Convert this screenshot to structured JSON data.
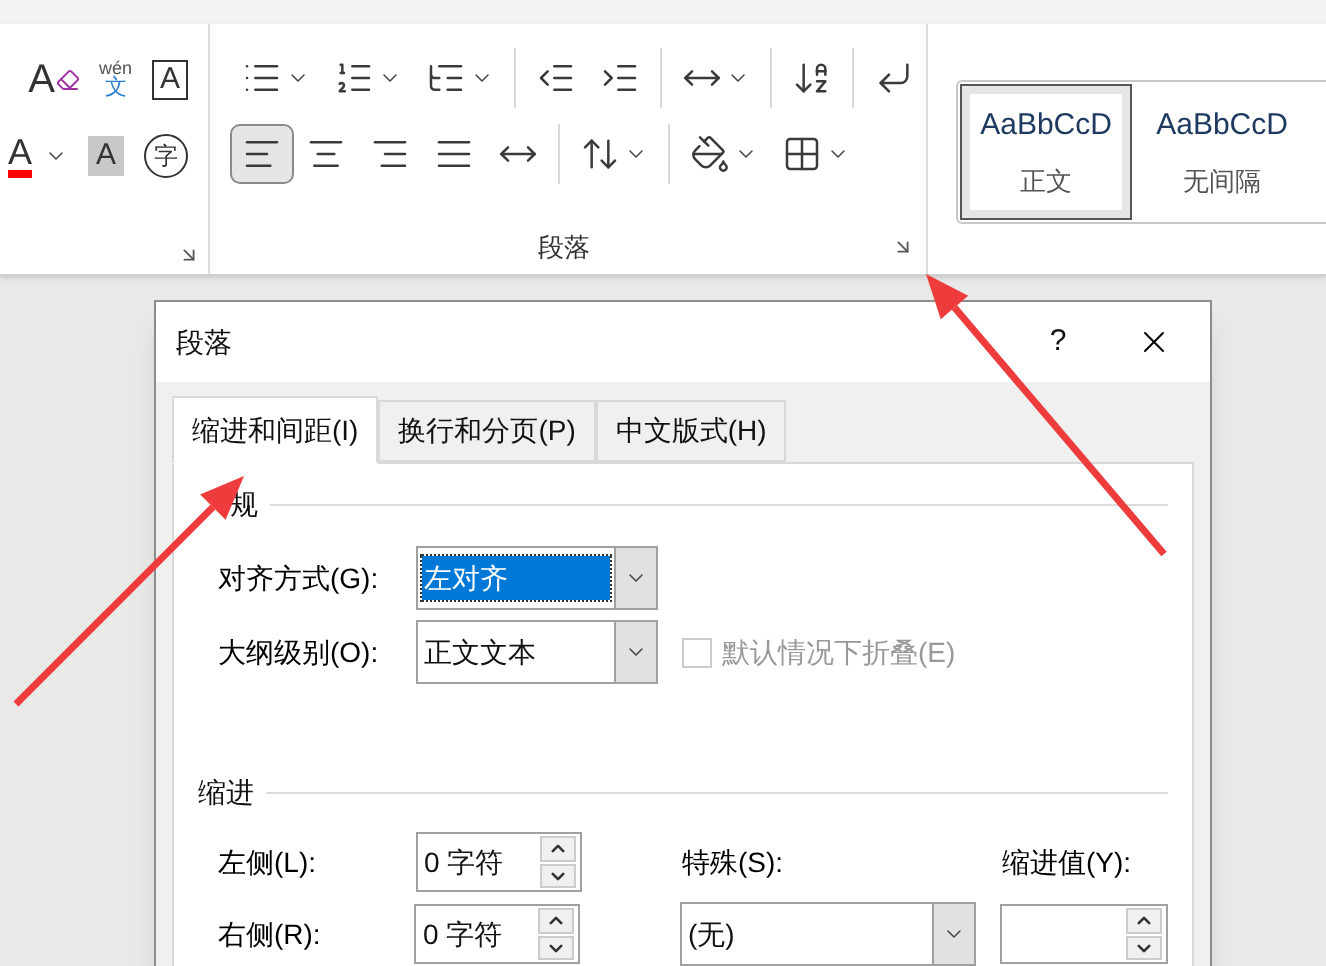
{
  "ribbon": {
    "font_group": {
      "rows": [
        [
          {
            "kind": "clear-format",
            "glyph": "A",
            "menu": false
          },
          {
            "kind": "phonetic",
            "ruby": "wén",
            "glyph": "文",
            "menu": false
          },
          {
            "kind": "char-border",
            "glyph": "A",
            "menu": false
          }
        ],
        [
          {
            "kind": "font-color",
            "glyph": "A",
            "color": "#ff0000",
            "menu": true
          },
          {
            "kind": "char-shading",
            "glyph": "A",
            "menu": false
          },
          {
            "kind": "enclose",
            "glyph": "字",
            "menu": false
          }
        ]
      ]
    },
    "paragraph_group": {
      "label": "段落",
      "rows": [
        [
          {
            "kind": "bullets",
            "menu": true,
            "selected": false
          },
          {
            "kind": "numbering",
            "menu": true,
            "selected": false
          },
          {
            "kind": "multilevel",
            "menu": true,
            "selected": false
          },
          {
            "kind": "separator"
          },
          {
            "kind": "decrease-indent",
            "menu": false,
            "selected": false
          },
          {
            "kind": "increase-indent",
            "menu": false,
            "selected": false
          },
          {
            "kind": "separator"
          },
          {
            "kind": "asian-layout",
            "menu": true,
            "selected": false
          },
          {
            "kind": "separator"
          },
          {
            "kind": "sort",
            "menu": false,
            "selected": false
          },
          {
            "kind": "separator"
          },
          {
            "kind": "show-marks",
            "menu": false,
            "selected": false
          }
        ],
        [
          {
            "kind": "align-left",
            "menu": false,
            "selected": true
          },
          {
            "kind": "align-center",
            "menu": false,
            "selected": false
          },
          {
            "kind": "align-right",
            "menu": false,
            "selected": false
          },
          {
            "kind": "justify",
            "menu": false,
            "selected": false
          },
          {
            "kind": "distributed",
            "menu": false,
            "selected": false
          },
          {
            "kind": "separator"
          },
          {
            "kind": "line-spacing",
            "menu": true,
            "selected": false
          },
          {
            "kind": "separator"
          },
          {
            "kind": "shading",
            "menu": true,
            "selected": false
          },
          {
            "kind": "borders",
            "menu": true,
            "selected": false
          }
        ]
      ]
    },
    "styles": [
      {
        "sample": "AaBbCcD",
        "name": "正文",
        "selected": true
      },
      {
        "sample": "AaBbCcD",
        "name": "无间隔",
        "selected": false
      }
    ]
  },
  "dialog": {
    "title": "段落",
    "help": "?",
    "tabs": [
      {
        "label": "缩进和间距(I)",
        "selected": true
      },
      {
        "label": "换行和分页(P)",
        "selected": false
      },
      {
        "label": "中文版式(H)",
        "selected": false
      }
    ],
    "general": {
      "heading": "规",
      "alignment": {
        "label": "对齐方式(G):",
        "value": "左对齐",
        "focused": true
      },
      "outline_level": {
        "label": "大纲级别(O):",
        "value": "正文文本",
        "focused": false
      },
      "collapse": {
        "label": "默认情况下折叠(E)",
        "checked": false,
        "disabled": true
      }
    },
    "indent": {
      "heading": "缩进",
      "left": {
        "label": "左侧(L):",
        "value": "0 字符"
      },
      "right": {
        "label": "右侧(R):",
        "value": "0 字符"
      },
      "special": {
        "label": "特殊(S):",
        "value": "(无)",
        "focused": false
      },
      "by": {
        "label": "缩进值(Y):"
      }
    }
  }
}
